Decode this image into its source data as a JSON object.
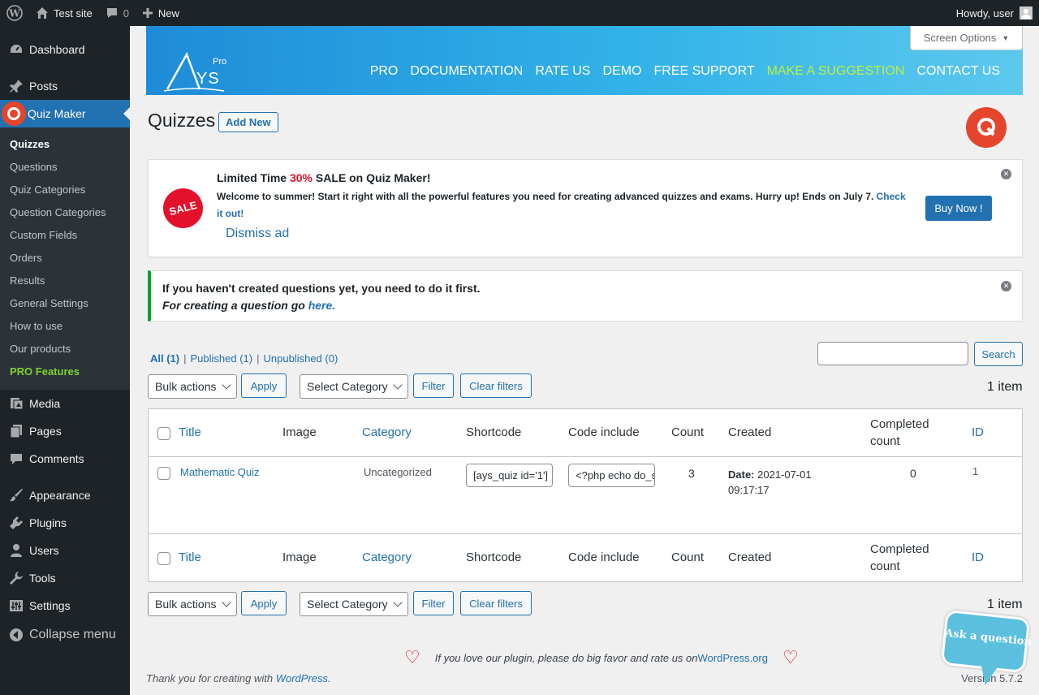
{
  "adminbar": {
    "site_name": "Test site",
    "comments_count": "0",
    "new_label": "New",
    "howdy": "Howdy, user"
  },
  "sidebar": {
    "dashboard": "Dashboard",
    "posts": "Posts",
    "quiz_maker": "Quiz Maker",
    "submenu": [
      "Quizzes",
      "Questions",
      "Quiz Categories",
      "Question Categories",
      "Custom Fields",
      "Orders",
      "Results",
      "General Settings",
      "How to use",
      "Our products",
      "PRO Features"
    ],
    "media": "Media",
    "pages": "Pages",
    "comments": "Comments",
    "appearance": "Appearance",
    "plugins": "Plugins",
    "users": "Users",
    "tools": "Tools",
    "settings": "Settings",
    "collapse": "Collapse menu"
  },
  "banner": {
    "logo_pro": "Pro",
    "logo_ys": "YS",
    "nav": [
      "PRO",
      "DOCUMENTATION",
      "RATE US",
      "DEMO",
      "FREE SUPPORT",
      "MAKE A SUGGESTION",
      "CONTACT US"
    ]
  },
  "screen_options": "Screen Options",
  "page": {
    "title": "Quizzes",
    "add_new": "Add New"
  },
  "sale": {
    "badge": "SALE",
    "title_pre": "Limited Time ",
    "title_pct": "30%",
    "title_post": " SALE on Quiz Maker!",
    "text": "Welcome to summer! Start it right with all the powerful features you need for creating advanced quizzes and exams. Hurry up! Ends on July 7. ",
    "check_link": "Check it out!",
    "dismiss": "Dismiss ad",
    "buy_now": "Buy Now !"
  },
  "notice": {
    "line1": "If you haven't created questions yet, you need to do it first.",
    "line2": "For creating a question go ",
    "link": "here."
  },
  "views": {
    "all": "All (1)",
    "published": "Published (1)",
    "unpublished": "Unpublished (0)",
    "sep": "|"
  },
  "search_button": "Search",
  "filters": {
    "bulk_actions": "Bulk actions",
    "apply": "Apply",
    "select_category": "Select Category",
    "filter": "Filter",
    "clear_filters": "Clear filters",
    "item_count": "1 item"
  },
  "table": {
    "columns": {
      "title": "Title",
      "image": "Image",
      "category": "Category",
      "shortcode": "Shortcode",
      "code_include": "Code include",
      "count": "Count",
      "created": "Created",
      "completed_count": "Completed count",
      "id": "ID"
    },
    "rows": [
      {
        "title": "Mathematic Quiz",
        "category": "Uncategorized",
        "shortcode": "[ays_quiz id='1']",
        "code_include": "<?php echo do_shortcode",
        "count": "3",
        "created_label": "Date:",
        "created_date": "2021-07-01",
        "created_time": "09:17:17",
        "completed": "0",
        "id": "1"
      }
    ]
  },
  "footer": {
    "love_pre": "If you love our plugin, please do big favor and rate us on ",
    "love_link": "WordPress.org",
    "thanks_pre": "Thank you for creating with ",
    "thanks_link": "WordPress",
    "thanks_post": ".",
    "version": "Version 5.7.2"
  },
  "ask_question": "Ask a question",
  "colors": {
    "accent": "#2271b1",
    "sidebar": "#1d2327",
    "sale_red": "#e5112b",
    "notice_green": "#00a32a",
    "pro_green": "#7fd131",
    "quiz_logo": "#e5452d"
  }
}
